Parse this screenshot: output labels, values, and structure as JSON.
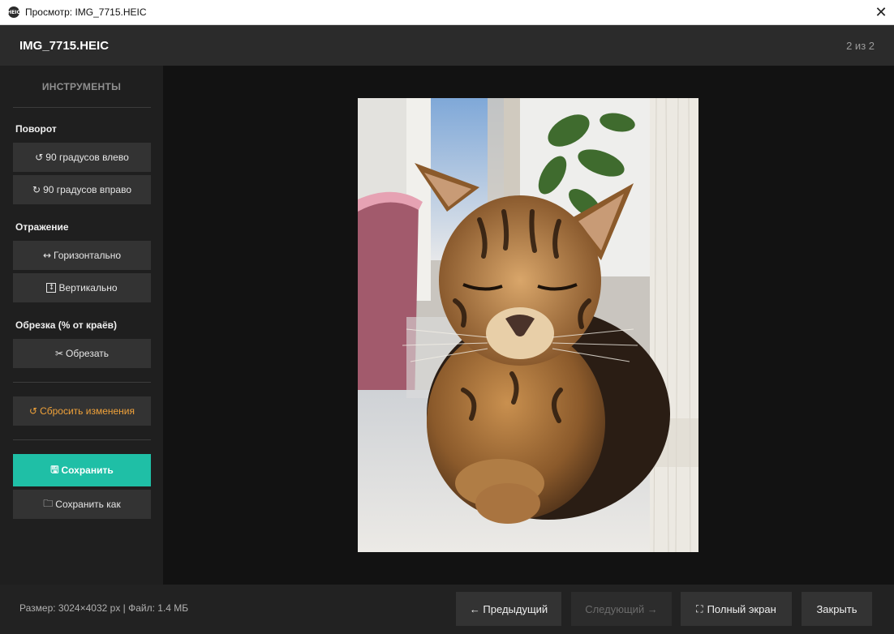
{
  "window": {
    "title": "Просмотр: IMG_7715.HEIC",
    "app_icon_text": "HEIC",
    "close_glyph": "✕"
  },
  "header": {
    "filename": "IMG_7715.HEIC",
    "counter": "2 из 2"
  },
  "sidebar": {
    "title": "ИНСТРУМЕНТЫ",
    "rotation": {
      "label": "Поворот",
      "left_label": "90 градусов влево",
      "left_icon": "↺",
      "right_label": "90 градусов вправо",
      "right_icon": "↻"
    },
    "flip": {
      "label": "Отражение",
      "horizontal_label": "Горизонтально",
      "horizontal_icon": "↔",
      "vertical_label": "Вертикально",
      "vertical_icon": "↕"
    },
    "crop": {
      "label": "Обрезка (% от краёв)",
      "button_label": "Обрезать",
      "button_icon": "✂"
    },
    "reset": {
      "label": "Сбросить изменения",
      "icon": "↺"
    },
    "save": {
      "label": "Сохранить",
      "icon": "🖫"
    },
    "save_as": {
      "label": "Сохранить как",
      "icon": "🗀"
    }
  },
  "footer": {
    "file_info": "Размер: 3024×4032 px  |  Файл: 1.4 МБ",
    "prev_label": "← Предыдущий",
    "next_label": "Следующий →",
    "fullscreen_label": "Полный экран",
    "fullscreen_icon": "⛶",
    "close_label": "Закрыть"
  },
  "colors": {
    "accent": "#1fbfa6",
    "reset": "#f0a23a",
    "viewer_bg": "#121212",
    "sidebar_bg": "#1f1f1f"
  }
}
